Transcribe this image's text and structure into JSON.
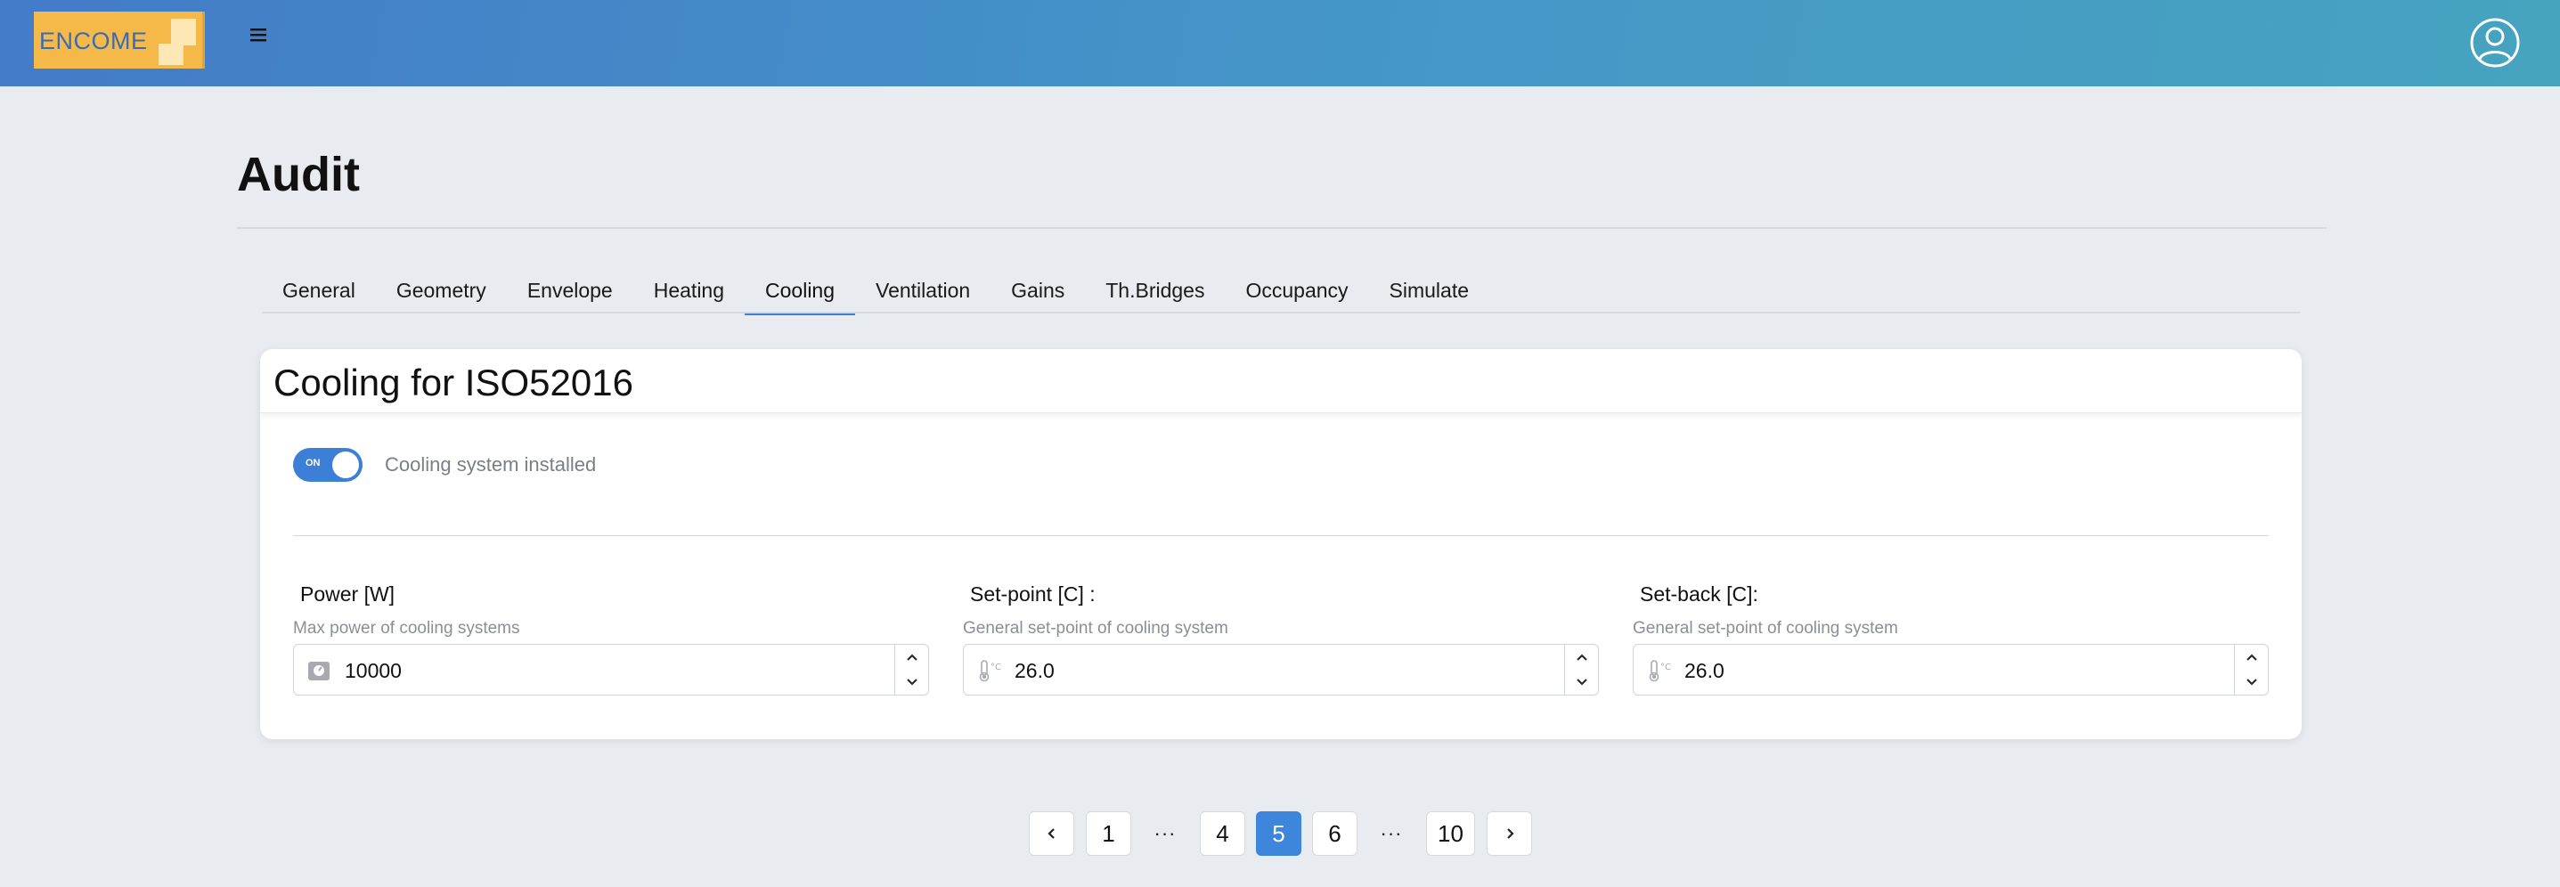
{
  "header": {
    "logo_text": "ENCOME",
    "menu_icon": "hamburger-icon",
    "user_icon": "user-circle-icon",
    "colors": {
      "gradient_start": "#437bc8",
      "gradient_end": "#46a4bf",
      "logo_bg": "#f5b94a"
    }
  },
  "page": {
    "title": "Audit"
  },
  "tabs": [
    {
      "label": "General",
      "active": false
    },
    {
      "label": "Geometry",
      "active": false
    },
    {
      "label": "Envelope",
      "active": false
    },
    {
      "label": "Heating",
      "active": false
    },
    {
      "label": "Cooling",
      "active": true
    },
    {
      "label": "Ventilation",
      "active": false
    },
    {
      "label": "Gains",
      "active": false
    },
    {
      "label": "Th.Bridges",
      "active": false
    },
    {
      "label": "Occupancy",
      "active": false
    },
    {
      "label": "Simulate",
      "active": false
    }
  ],
  "card": {
    "title": "Cooling for ISO52016",
    "toggle": {
      "state_label": "ON",
      "on": true,
      "label": "Cooling system installed"
    },
    "fields": [
      {
        "label": "Power [W]",
        "help": "Max power of cooling systems",
        "value": "10000",
        "icon": "gauge-icon"
      },
      {
        "label": "Set-point [C] :",
        "help": "General set-point of cooling system",
        "value": "26.0",
        "icon": "thermometer-icon"
      },
      {
        "label": "Set-back [C]:",
        "help": "General set-point of cooling system",
        "value": "26.0",
        "icon": "thermometer-icon"
      }
    ]
  },
  "pagination": {
    "prev_icon": "chevron-left-icon",
    "next_icon": "chevron-right-icon",
    "pages": [
      "1",
      "4",
      "5",
      "6",
      "10"
    ],
    "ellipsis": "···",
    "current": "5",
    "accent": "#3e85dc"
  }
}
